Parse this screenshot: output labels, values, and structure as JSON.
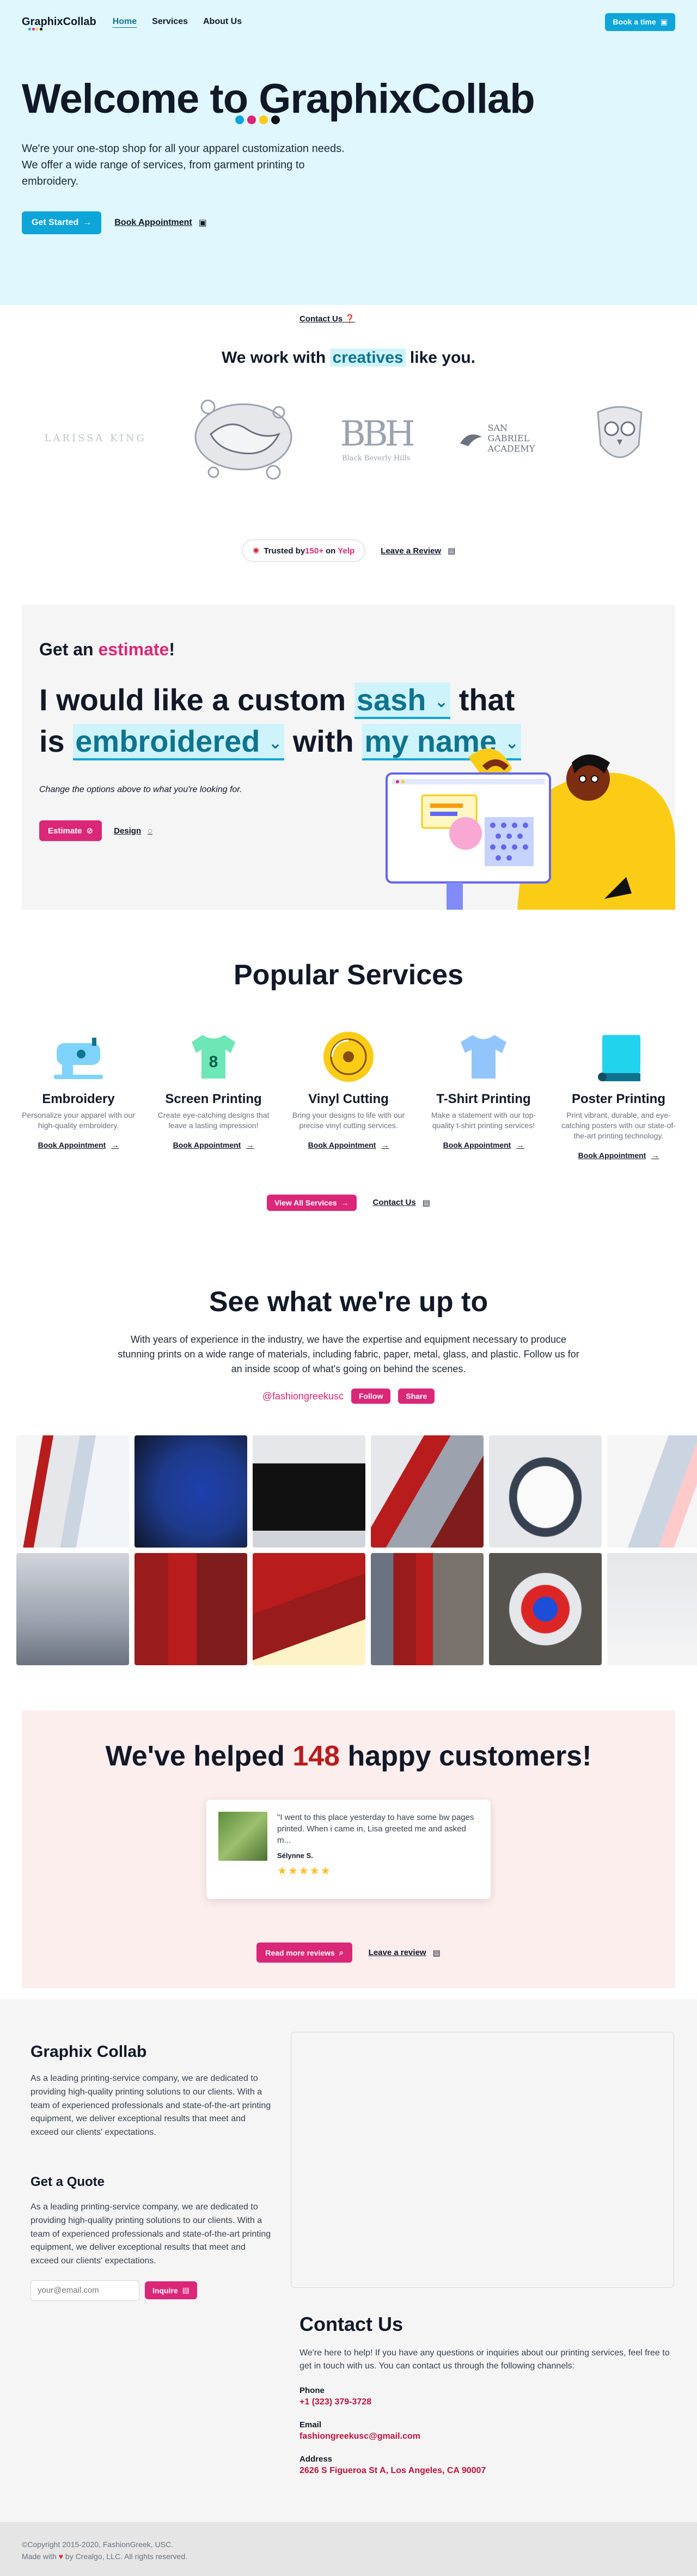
{
  "nav": {
    "brand": "GraphixCollab",
    "links": [
      "Home",
      "Services",
      "About Us"
    ],
    "contact": "Contact Us",
    "book": "Book a time"
  },
  "hero": {
    "title": "Welcome to GraphixCollab",
    "desc": "We're your one-stop shop for all your apparel customization needs. We offer a wide range of services, from garment printing to embroidery.",
    "cta": "Get Started",
    "book": "Book Appointment"
  },
  "creatives": {
    "title_pre": "We work with ",
    "title_hl": "creatives",
    "title_post": " like you.",
    "logos": [
      "LARISSA KING",
      "Black Beverly Hills",
      "SAN GABRIEL ACADEMY"
    ],
    "yelp_pre": "Trusted by ",
    "yelp_count": "150+",
    "yelp_on": " on ",
    "yelp_name": "Yelp",
    "review_link": "Leave a Review"
  },
  "estimate": {
    "sub_pre": "Get an ",
    "sub_hl": "estimate",
    "sub_post": "!",
    "p1": "I would like a custom",
    "opt1": "sash",
    "p2": "that is",
    "opt2": "embroidered",
    "p3": "with",
    "opt3": "my name",
    "note": "Change the options above to what you're looking for.",
    "btn": "Estimate",
    "design": "Design"
  },
  "services": {
    "title": "Popular Services",
    "items": [
      {
        "name": "Embroidery",
        "desc": "Personalize your apparel with our high-quality embroidery.",
        "link": "Book Appointment"
      },
      {
        "name": "Screen Printing",
        "desc": "Create eye-catching designs that leave a lasting impression!",
        "link": "Book Appointment"
      },
      {
        "name": "Vinyl Cutting",
        "desc": "Bring your designs to life with our precise vinyl cutting services.",
        "link": "Book Appointment"
      },
      {
        "name": "T-Shirt Printing",
        "desc": "Make a statement with our top-quality t-shirt printing services!",
        "link": "Book Appointment"
      },
      {
        "name": "Poster Printing",
        "desc": "Print vibrant, durable, and eye-catching posters with our state-of-the-art printing technology.",
        "link": "Book Appointment"
      }
    ],
    "view_all": "View All Services",
    "contact": "Contact Us"
  },
  "upto": {
    "title": "See what we're up to",
    "desc": "With years of experience in the industry, we have the expertise and equipment necessary to produce stunning prints on a wide range of materials, including fabric, paper, metal, glass, and plastic. Follow us for an inside scoop of what's going on behind the scenes.",
    "handle": "@fashiongreekusc",
    "follow": "Follow",
    "share": "Share"
  },
  "testimonials": {
    "title_pre": "We've helped ",
    "count": "148",
    "title_post": " happy customers!",
    "review_text": "\"I went to this place yesterday to have some bw pages printed. When i came in, Lisa greeted me and asked m...",
    "reviewer": "Sélynne S.",
    "stars": "★★★★★",
    "more": "Read more reviews",
    "leave": "Leave a review"
  },
  "info": {
    "title": "Graphix Collab",
    "about": "As a leading printing-service company, we are dedicated to providing high-quality printing solutions to our clients. With a team of experienced professionals and state-of-the-art printing equipment, we deliver exceptional results that meet and exceed our clients' expectations.",
    "quote_title": "Get a Quote",
    "quote_text": "As a leading printing-service company, we are dedicated to providing high-quality printing solutions to our clients. With a team of experienced professionals and state-of-the-art printing equipment, we deliver exceptional results that meet and exceed our clients' expectations.",
    "email_placeholder": "your@email.com",
    "inquire": "Inquire"
  },
  "contact": {
    "title": "Contact Us",
    "desc": "We're here to help! If you have any questions or inquiries about our printing services, feel free to get in touch with us. You can contact us through the following channels:",
    "phone_label": "Phone",
    "phone": "+1 (323) 379-3728",
    "email_label": "Email",
    "email": "fashiongreekusc@gmail.com",
    "address_label": "Address",
    "address": "2626 S Figueroa St A, Los Angeles, CA 90007"
  },
  "footer": {
    "copyright": "©Copyright 2015-2020, FashionGreek, USC.",
    "made_pre": "Made with ",
    "made_post": " by Crealgo, LLC. All rights reserved."
  },
  "colors": {
    "cyan": "#0ea5d9",
    "pink": "#db2777",
    "hero_bg": "#dff7fd",
    "red": "#b91c1c"
  }
}
